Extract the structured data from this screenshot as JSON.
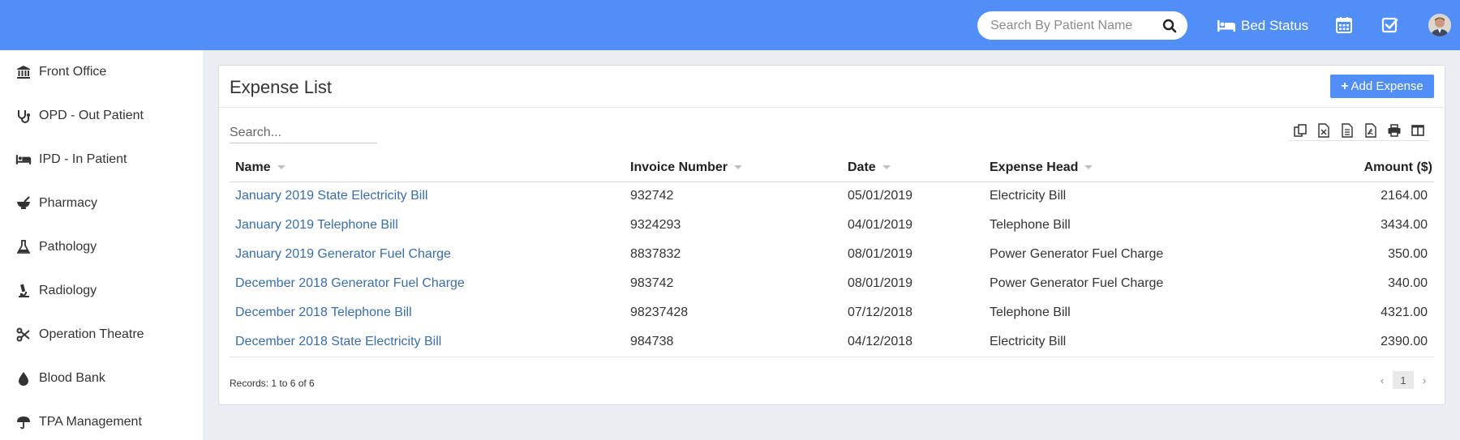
{
  "header": {
    "search_placeholder": "Search By Patient Name",
    "bed_status_label": "Bed Status",
    "accent": "#518ff7"
  },
  "sidebar": {
    "items": [
      {
        "label": "Front Office",
        "icon": "building-icon"
      },
      {
        "label": "OPD - Out Patient",
        "icon": "stethoscope-icon"
      },
      {
        "label": "IPD - In Patient",
        "icon": "bed-icon"
      },
      {
        "label": "Pharmacy",
        "icon": "mortar-pestle-icon"
      },
      {
        "label": "Pathology",
        "icon": "flask-icon"
      },
      {
        "label": "Radiology",
        "icon": "microscope-icon"
      },
      {
        "label": "Operation Theatre",
        "icon": "scissors-icon"
      },
      {
        "label": "Blood Bank",
        "icon": "blood-drop-icon"
      },
      {
        "label": "TPA Management",
        "icon": "umbrella-icon"
      }
    ]
  },
  "panel": {
    "title": "Expense List",
    "add_button_label": "Add Expense",
    "search_placeholder": "Search...",
    "columns": [
      "Name",
      "Invoice Number",
      "Date",
      "Expense Head",
      "Amount ($)"
    ],
    "rows": [
      {
        "name": "January 2019 State Electricity Bill",
        "invoice": "932742",
        "date": "05/01/2019",
        "head": "Electricity Bill",
        "amount": "2164.00"
      },
      {
        "name": "January 2019 Telephone Bill",
        "invoice": "9324293",
        "date": "04/01/2019",
        "head": "Telephone Bill",
        "amount": "3434.00"
      },
      {
        "name": "January 2019 Generator Fuel Charge",
        "invoice": "8837832",
        "date": "08/01/2019",
        "head": "Power Generator Fuel Charge",
        "amount": "350.00"
      },
      {
        "name": "December 2018 Generator Fuel Charge",
        "invoice": "983742",
        "date": "08/01/2019",
        "head": "Power Generator Fuel Charge",
        "amount": "340.00"
      },
      {
        "name": "December 2018 Telephone Bill",
        "invoice": "98237428",
        "date": "07/12/2018",
        "head": "Telephone Bill",
        "amount": "4321.00"
      },
      {
        "name": "December 2018 State Electricity Bill",
        "invoice": "984738",
        "date": "04/12/2018",
        "head": "Electricity Bill",
        "amount": "2390.00"
      }
    ],
    "records_text": "Records: 1 to 6 of 6",
    "pagination": {
      "prev": "‹",
      "current": "1",
      "next": "›"
    },
    "toolbar_icons": [
      "copy-icon",
      "excel-icon",
      "csv-icon",
      "pdf-icon",
      "print-icon",
      "columns-icon"
    ]
  }
}
